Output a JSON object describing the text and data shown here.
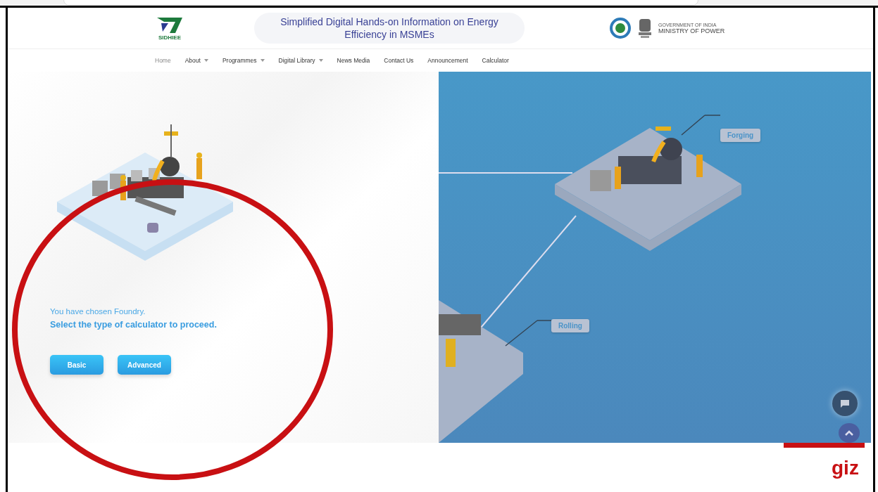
{
  "header": {
    "logo_text": "SIDHIEE",
    "title": "Simplified Digital Hands-on Information on Energy Efficiency in MSMEs",
    "ministry_caption": "GOVERNMENT OF INDIA",
    "ministry_name": "MINISTRY OF POWER"
  },
  "nav": [
    {
      "label": "Home",
      "selected": true,
      "dropdown": false
    },
    {
      "label": "About",
      "selected": false,
      "dropdown": true
    },
    {
      "label": "Programmes",
      "selected": false,
      "dropdown": true
    },
    {
      "label": "Digital Library",
      "selected": false,
      "dropdown": true
    },
    {
      "label": "News Media",
      "selected": false,
      "dropdown": false
    },
    {
      "label": "Contact Us",
      "selected": false,
      "dropdown": false
    },
    {
      "label": "Announcement",
      "selected": false,
      "dropdown": false
    },
    {
      "label": "Calculator",
      "selected": false,
      "dropdown": false
    }
  ],
  "selection": {
    "chosen": "You have chosen Foundry.",
    "prompt": "Select the type of calculator to proceed."
  },
  "buttons": [
    "Basic",
    "Advanced"
  ],
  "process_map": {
    "labels": [
      "Forging",
      "Rolling"
    ]
  },
  "footer": {
    "brand": "giz"
  }
}
